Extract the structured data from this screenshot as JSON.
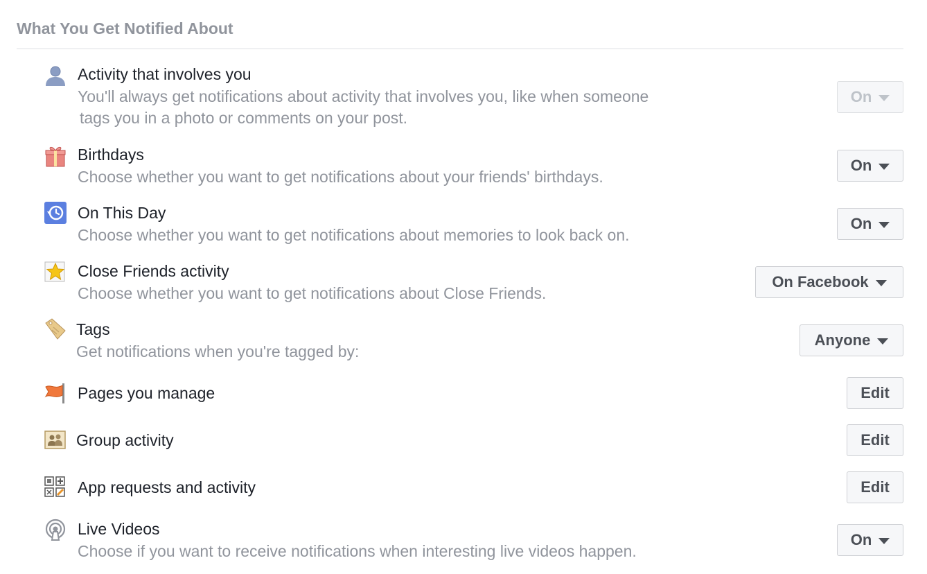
{
  "section": {
    "title": "What You Get Notified About"
  },
  "rows": [
    {
      "icon": "person-icon",
      "title": "Activity that involves you",
      "desc1": "You'll always get notifications about activity that involves you, like when someone",
      "desc2": "tags you in a photo or comments on your post.",
      "control": "On",
      "disabled": true
    },
    {
      "icon": "gift-icon",
      "title": "Birthdays",
      "desc1": "Choose whether you want to get notifications about your friends' birthdays.",
      "control": "On"
    },
    {
      "icon": "clock-rewind-icon",
      "title": "On This Day",
      "desc1": "Choose whether you want to get notifications about memories to look back on.",
      "control": "On"
    },
    {
      "icon": "star-icon",
      "title": "Close Friends activity",
      "desc1": "Choose whether you want to get notifications about Close Friends.",
      "control": "On Facebook"
    },
    {
      "icon": "tag-icon",
      "title": "Tags",
      "desc1": "Get notifications when you're tagged by:",
      "control": "Anyone"
    },
    {
      "icon": "flag-icon",
      "title": "Pages you manage",
      "control": "Edit"
    },
    {
      "icon": "group-icon",
      "title": "Group activity",
      "control": "Edit"
    },
    {
      "icon": "apps-icon",
      "title": "App requests and activity",
      "control": "Edit"
    },
    {
      "icon": "live-broadcast-icon",
      "title": "Live Videos",
      "desc1": "Choose if you want to receive notifications when interesting live videos happen.",
      "control": "On"
    }
  ],
  "colors": {
    "title": "#1d2129",
    "muted": "#90949c",
    "button_text": "#4b4f56",
    "button_bg": "#f6f7f9",
    "border": "#ced0d4"
  }
}
